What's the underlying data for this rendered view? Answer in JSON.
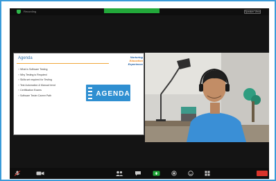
{
  "window": {
    "recording_label": "Recording",
    "banner_label": "",
    "speaker_view_label": "Speaker View"
  },
  "slide": {
    "title": "Agenda",
    "logo_lines": [
      "Nurturing",
      "Education",
      "Experience"
    ],
    "bullets": [
      "What is Software Testing",
      "Why Testing is Required",
      "Skills set required for Testing",
      "Test Automation & Manual trend",
      "Certification Exams",
      "Software Tester Career Path"
    ],
    "card_text": "AGENDA"
  },
  "colors": {
    "frame_border": "#3a9bd9",
    "title": "#2e6fa8",
    "rule": "#f0a63a",
    "card": "#2f8fd1",
    "shirt": "#3a8fd6",
    "end_button": "#d9332b",
    "zoom_green": "#22a83a"
  },
  "controls": {
    "icons": [
      "microphone-icon",
      "video-camera-icon",
      "participants-icon",
      "chat-icon",
      "share-screen-icon",
      "record-icon",
      "reactions-icon",
      "apps-icon"
    ],
    "end_label": ""
  }
}
